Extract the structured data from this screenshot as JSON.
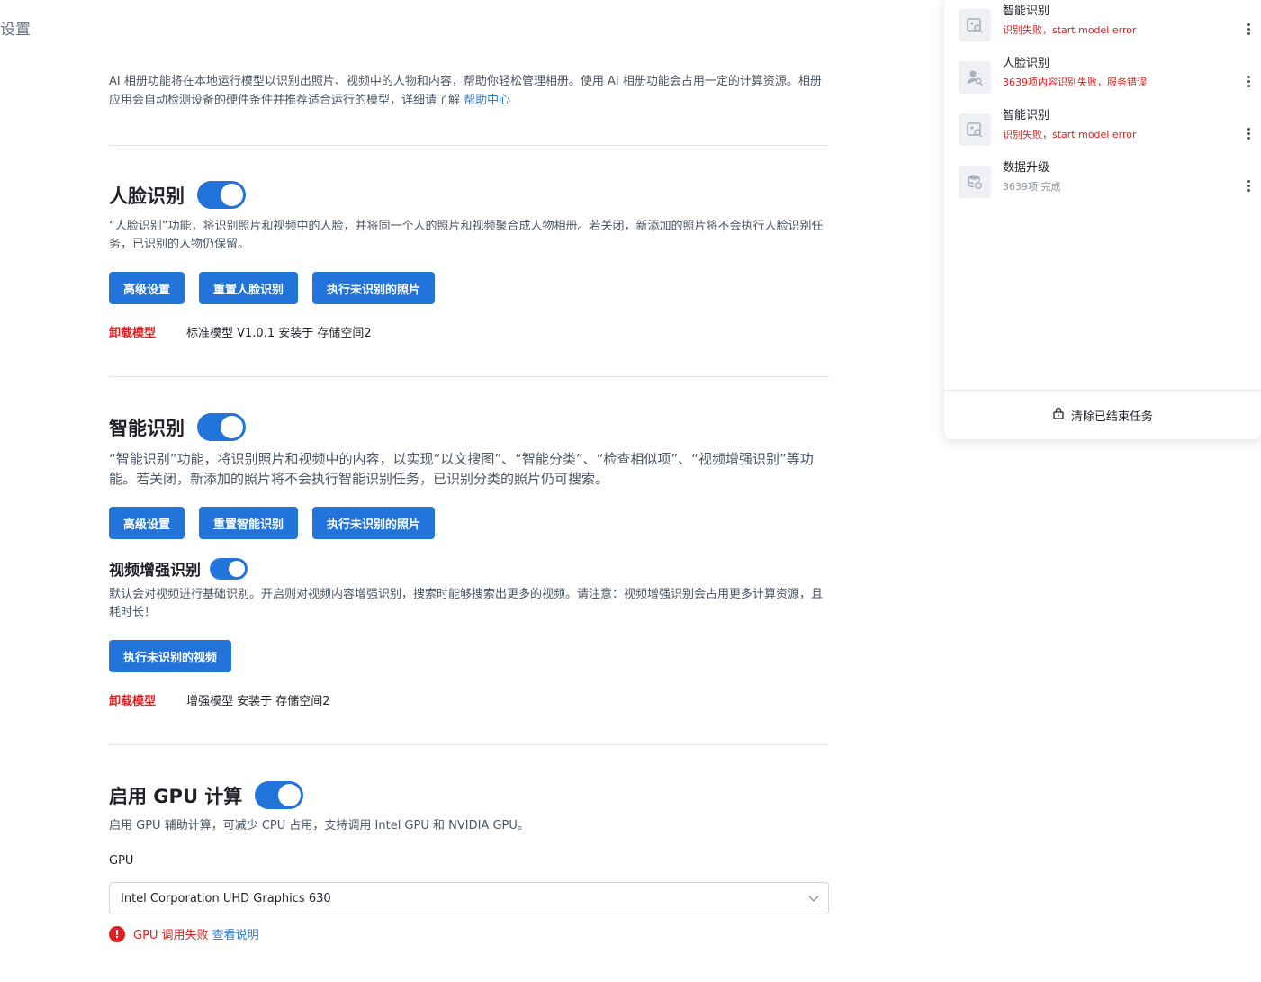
{
  "page": {
    "title": "设置"
  },
  "intro": {
    "text": "AI 相册功能将在本地运行模型以识别出照片、视频中的人物和内容，帮助你轻松管理相册。使用 AI 相册功能会占用一定的计算资源。相册应用会自动检测设备的硬件条件并推荐适合运行的模型，详细请了解 ",
    "link": "帮助中心"
  },
  "face": {
    "title": "人脸识别",
    "enabled": true,
    "desc": "“人脸识别”功能，将识别照片和视频中的人脸，并将同一个人的照片和视频聚合成人物相册。若关闭，新添加的照片将不会执行人脸识别任务，已识别的人物仍保留。",
    "buttons": [
      "高级设置",
      "重置人脸识别",
      "执行未识别的照片"
    ],
    "uninstall": "卸载模型",
    "model_info": "标准模型 V1.0.1 安装于 存储空间2"
  },
  "smart": {
    "title": "智能识别",
    "enabled": true,
    "desc": "“智能识别”功能，将识别照片和视频中的内容，以实现“以文搜图”、“智能分类”、“检查相似项”、“视频增强识别”等功能。若关闭，新添加的照片将不会执行智能识别任务，已识别分类的照片仍可搜索。",
    "buttons": [
      "高级设置",
      "重置智能识别",
      "执行未识别的照片"
    ]
  },
  "video": {
    "title": "视频增强识别",
    "enabled": true,
    "desc": "默认会对视频进行基础识别。开启则对视频内容增强识别，搜索时能够搜索出更多的视频。请注意：视频增强识别会占用更多计算资源，且耗时长！",
    "button": "执行未识别的视频",
    "uninstall": "卸载模型",
    "model_info": "增强模型 安装于 存储空间2"
  },
  "gpu": {
    "title": "启用 GPU 计算",
    "enabled": true,
    "desc": "启用 GPU 辅助计算，可减少 CPU 占用，支持调用 Intel GPU 和 NVIDIA GPU。",
    "field_label": "GPU",
    "selected": "Intel Corporation UHD Graphics 630",
    "error_icon": "!",
    "error_text": "GPU 调用失败",
    "error_link": "查看说明"
  },
  "tasks": {
    "items": [
      {
        "name": "智能识别",
        "status": "识别失败，start model error",
        "status_type": "error",
        "icon": "image-search-icon"
      },
      {
        "name": "人脸识别",
        "status": "3639项内容识别失败，服务错误",
        "status_type": "error",
        "icon": "person-search-icon"
      },
      {
        "name": "智能识别",
        "status": "识别失败，start model error",
        "status_type": "error",
        "icon": "image-search-icon"
      },
      {
        "name": "数据升级",
        "status": "3639项 完成",
        "status_type": "done",
        "icon": "database-icon"
      }
    ],
    "clear_label": "清除已结束任务"
  },
  "colors": {
    "accent": "#2274da",
    "error": "#e02020",
    "link": "#2b7cd3"
  }
}
